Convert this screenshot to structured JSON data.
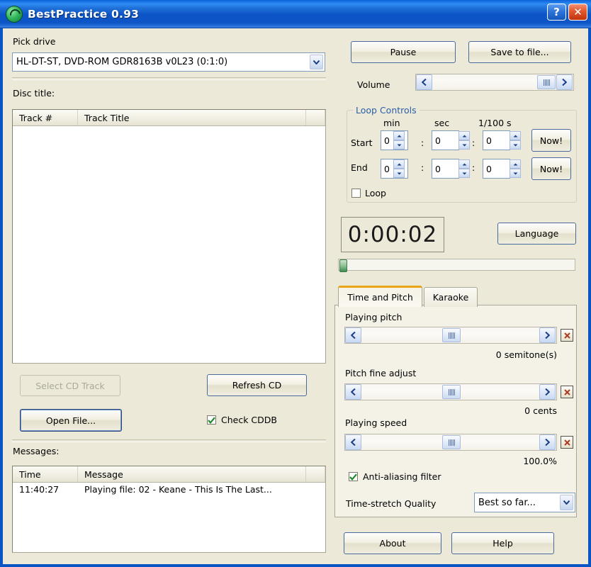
{
  "window": {
    "title": "BestPractice 0.93",
    "icon": "app-disc-icon",
    "help_button": "?",
    "close_button": "✕",
    "titlebar_color": "#0d55c6",
    "face_color": "#ece9d8"
  },
  "left": {
    "pick_drive_label": "Pick drive",
    "drive_value": "HL-DT-ST, DVD-ROM GDR8163B v0L23 (0:1:0)",
    "disc_title_label": "Disc title:",
    "track_list": {
      "columns": [
        "Track #",
        "Track Title"
      ],
      "rows": []
    },
    "select_cd_track_label": "Select CD Track",
    "refresh_cd_label": "Refresh CD",
    "open_file_label": "Open File...",
    "check_cddb_label": "Check CDDB",
    "check_cddb_checked": true,
    "messages_label": "Messages:",
    "message_list": {
      "columns": [
        "Time",
        "Message"
      ],
      "rows": [
        {
          "time": "11:40:27",
          "message": "Playing file: 02 - Keane - This Is The Last..."
        }
      ]
    }
  },
  "right": {
    "pause_label": "Pause",
    "save_to_file_label": "Save to file...",
    "volume_label": "Volume",
    "volume_thumb_percent": 89,
    "loop_controls": {
      "group_label": "Loop Controls",
      "group_label_color": "#2a5fa8",
      "col_min": "min",
      "col_sec": "sec",
      "col_hundredths": "1/100 s",
      "start_label": "Start",
      "end_label": "End",
      "start_min": "0",
      "start_sec": "0",
      "start_hun": "0",
      "end_min": "0",
      "end_sec": "0",
      "end_hun": "0",
      "now_label": "Now!",
      "loop_label": "Loop",
      "loop_checked": false,
      "colon": ":"
    },
    "timer_value": "0:00:02",
    "language_label": "Language",
    "position_percent": 0,
    "tabs": [
      {
        "id": "time-and-pitch",
        "label": "Time and Pitch",
        "active": true
      },
      {
        "id": "karaoke",
        "label": "Karaoke",
        "active": false
      }
    ],
    "time_and_pitch": {
      "playing_pitch_label": "Playing pitch",
      "playing_pitch_value": "0 semitone(s)",
      "playing_pitch_percent": 50,
      "pitch_fine_label": "Pitch fine adjust",
      "pitch_fine_value": "0 cents",
      "pitch_fine_percent": 50,
      "playing_speed_label": "Playing speed",
      "playing_speed_value": "100.0%",
      "playing_speed_percent": 50,
      "reset_button": "✕",
      "anti_alias_label": "Anti-aliasing filter",
      "anti_alias_checked": true,
      "quality_label": "Time-stretch Quality",
      "quality_value": "Best so far..."
    },
    "about_label": "About",
    "help_label": "Help"
  }
}
